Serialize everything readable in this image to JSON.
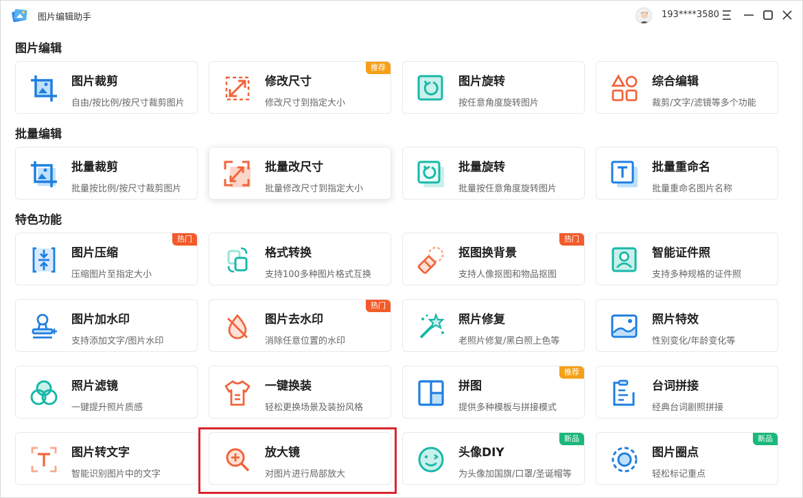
{
  "window": {
    "title": "图片编辑助手",
    "user_phone": "193****3580"
  },
  "sections": [
    {
      "title": "图片编辑",
      "cards": [
        {
          "name": "图片裁剪",
          "desc": "自由/按比例/按尺寸裁剪图片",
          "icon": "crop-icon",
          "badge": ""
        },
        {
          "name": "修改尺寸",
          "desc": "修改尺寸到指定大小",
          "icon": "resize-icon",
          "badge": "推荐"
        },
        {
          "name": "图片旋转",
          "desc": "按任意角度旋转图片",
          "icon": "rotate-icon",
          "badge": ""
        },
        {
          "name": "综合编辑",
          "desc": "裁剪/文字/滤镜等多个功能",
          "icon": "shapes-icon",
          "badge": ""
        }
      ]
    },
    {
      "title": "批量编辑",
      "cards": [
        {
          "name": "批量裁剪",
          "desc": "批量按比例/按尺寸裁剪图片",
          "icon": "batch-crop-icon",
          "badge": ""
        },
        {
          "name": "批量改尺寸",
          "desc": "批量修改尺寸到指定大小",
          "icon": "batch-resize-icon",
          "badge": ""
        },
        {
          "name": "批量旋转",
          "desc": "批量按任意角度旋转图片",
          "icon": "batch-rotate-icon",
          "badge": ""
        },
        {
          "name": "批量重命名",
          "desc": "批量重命名图片名称",
          "icon": "batch-rename-icon",
          "badge": ""
        }
      ]
    },
    {
      "title": "特色功能",
      "cards": [
        {
          "name": "图片压缩",
          "desc": "压缩图片至指定大小",
          "icon": "compress-icon",
          "badge": "热门"
        },
        {
          "name": "格式转换",
          "desc": "支持100多种图片格式互换",
          "icon": "convert-icon",
          "badge": ""
        },
        {
          "name": "抠图换背景",
          "desc": "支持人像抠图和物品抠图",
          "icon": "eraser-icon",
          "badge": "热门"
        },
        {
          "name": "智能证件照",
          "desc": "支持多种规格的证件照",
          "icon": "id-photo-icon",
          "badge": ""
        },
        {
          "name": "图片加水印",
          "desc": "支持添加文字/图片水印",
          "icon": "stamp-icon",
          "badge": ""
        },
        {
          "name": "图片去水印",
          "desc": "消除任意位置的水印",
          "icon": "remove-watermark-icon",
          "badge": "热门"
        },
        {
          "name": "照片修复",
          "desc": "老照片修复/黑白照上色等",
          "icon": "magic-wand-icon",
          "badge": ""
        },
        {
          "name": "照片特效",
          "desc": "性别变化/年龄变化等",
          "icon": "landscape-icon",
          "badge": ""
        },
        {
          "name": "照片滤镜",
          "desc": "一键提升照片质感",
          "icon": "filter-icon",
          "badge": ""
        },
        {
          "name": "一键换装",
          "desc": "轻松更换场景及装扮风格",
          "icon": "tshirt-icon",
          "badge": ""
        },
        {
          "name": "拼图",
          "desc": "提供多种模板与拼接模式",
          "icon": "collage-icon",
          "badge": "推荐"
        },
        {
          "name": "台词拼接",
          "desc": "经典台词剧照拼接",
          "icon": "clipboard-icon",
          "badge": ""
        },
        {
          "name": "图片转文字",
          "desc": "智能识别图片中的文字",
          "icon": "ocr-icon",
          "badge": ""
        },
        {
          "name": "放大镜",
          "desc": "对图片进行局部放大",
          "icon": "magnifier-icon",
          "badge": ""
        },
        {
          "name": "头像DIY",
          "desc": "为头像加国旗/口罩/圣诞帽等",
          "icon": "smiley-icon",
          "badge": "新品"
        },
        {
          "name": "图片圈点",
          "desc": "轻松标记重点",
          "icon": "circle-mark-icon",
          "badge": "新品"
        }
      ]
    }
  ],
  "colors": {
    "blue": "#1e7ee0",
    "orange": "#f0643a",
    "teal": "#16b8a8",
    "badge_recommend": "#f5a018",
    "badge_hot": "#f25b2a",
    "badge_new": "#1bb77b",
    "highlight": "#d9232d"
  }
}
